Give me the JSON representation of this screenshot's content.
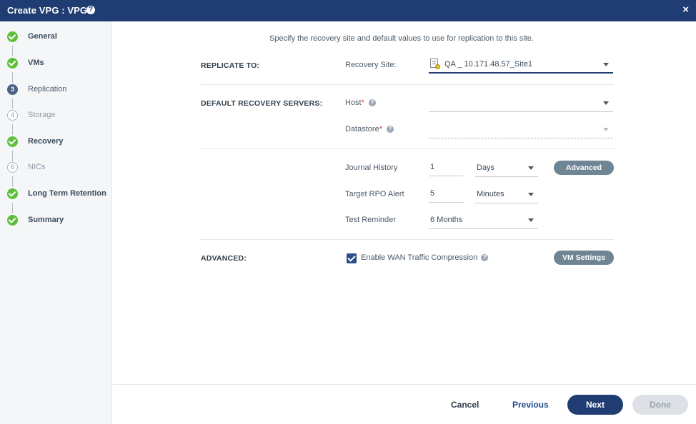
{
  "window": {
    "title": "Create VPG : VPG1",
    "help_glyph": "?",
    "close_glyph": "×"
  },
  "steps": [
    {
      "label": "General",
      "state": "done",
      "marker": ""
    },
    {
      "label": "VMs",
      "state": "done",
      "marker": ""
    },
    {
      "label": "Replication",
      "state": "current",
      "marker": "3"
    },
    {
      "label": "Storage",
      "state": "todo",
      "marker": "4"
    },
    {
      "label": "Recovery",
      "state": "done",
      "marker": ""
    },
    {
      "label": "NICs",
      "state": "todo",
      "marker": "6"
    },
    {
      "label": "Long Term Retention",
      "state": "done",
      "marker": ""
    },
    {
      "label": "Summary",
      "state": "done",
      "marker": ""
    }
  ],
  "intro": "Specify the recovery site and default values to use for replication to this site.",
  "replicate_to": {
    "section_label": "REPLICATE TO:",
    "recovery_site_label": "Recovery Site:",
    "recovery_site_value": "QA _ 10.171.48.57_Site1"
  },
  "default_servers": {
    "section_label": "DEFAULT RECOVERY SERVERS:",
    "host_label": "Host",
    "host_value": "",
    "datastore_label": "Datastore",
    "datastore_value": "",
    "required_mark": "*",
    "help_glyph": "?"
  },
  "history": {
    "journal_label": "Journal History",
    "journal_value": "1",
    "journal_unit": "Days",
    "advanced_button": "Advanced",
    "rpo_label": "Target RPO Alert",
    "rpo_value": "5",
    "rpo_unit": "Minutes",
    "test_label": "Test Reminder",
    "test_value": "6 Months"
  },
  "advanced": {
    "section_label": "ADVANCED:",
    "wan_label": "Enable WAN Traffic Compression",
    "wan_checked": true,
    "help_glyph": "?",
    "vm_settings_button": "VM Settings"
  },
  "footer": {
    "cancel": "Cancel",
    "previous": "Previous",
    "next": "Next",
    "done": "Done"
  },
  "colors": {
    "header": "#1f3d72",
    "step_done": "#5fbf3a",
    "step_current": "#4a6186",
    "pill_button": "#6f8594",
    "done_disabled": "#dde1e5"
  }
}
